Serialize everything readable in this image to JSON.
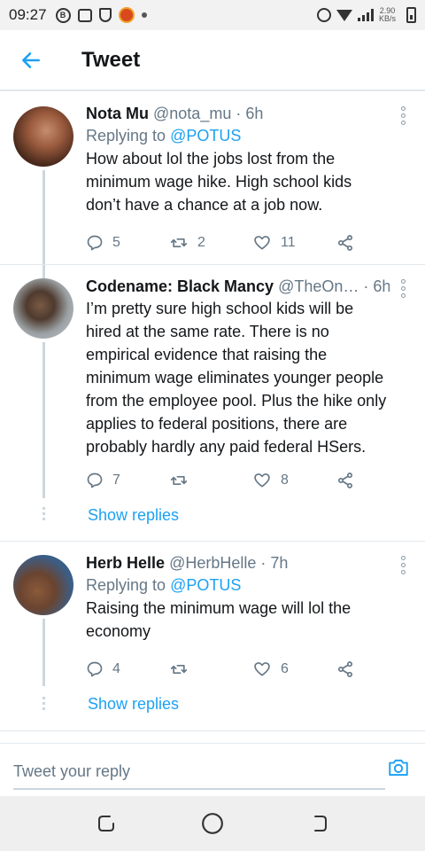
{
  "status_bar": {
    "time": "09:27",
    "net_speed_value": "2.90",
    "net_speed_unit": "KB/s",
    "icons": [
      "b-icon",
      "square-icon",
      "shield-icon",
      "app-icon",
      "dot-icon",
      "alarm-icon",
      "wifi-icon",
      "signal-icon",
      "battery-icon"
    ]
  },
  "header": {
    "title": "Tweet",
    "back_icon": "arrow-left-icon"
  },
  "replies": [
    {
      "name": "Nota Mu",
      "handle": "@nota_mu · 6h",
      "replying_prefix": "Replying to",
      "replying_to": "@POTUS",
      "text": "How about lol the jobs lost from the minimum wage hike. High school kids don’t have a chance at a job now.",
      "reply_count": "5",
      "retweet_count": "2",
      "like_count": "11"
    },
    {
      "name": "Codename: Black Mancy",
      "handle": "@TheOn… · 6h",
      "text": "I’m pretty sure high school kids will be hired at the same rate. There is no empirical evidence that raising the minimum wage eliminates younger people from the employee pool. Plus the hike only applies to federal positions, there are probably hardly any paid federal HSers.",
      "reply_count": "7",
      "retweet_count": "",
      "like_count": "8",
      "show_replies": "Show replies"
    },
    {
      "name": "Herb Helle",
      "handle": "@HerbHelle · 7h",
      "replying_prefix": "Replying to",
      "replying_to": "@POTUS",
      "text": "Raising the minimum wage will lol the economy",
      "reply_count": "4",
      "retweet_count": "",
      "like_count": "6",
      "show_replies": "Show replies"
    }
  ],
  "reply_bar": {
    "placeholder": "Tweet your reply"
  },
  "colors": {
    "accent": "#1da1f2",
    "secondary_text": "#657786",
    "divider": "#e1e8ed"
  }
}
